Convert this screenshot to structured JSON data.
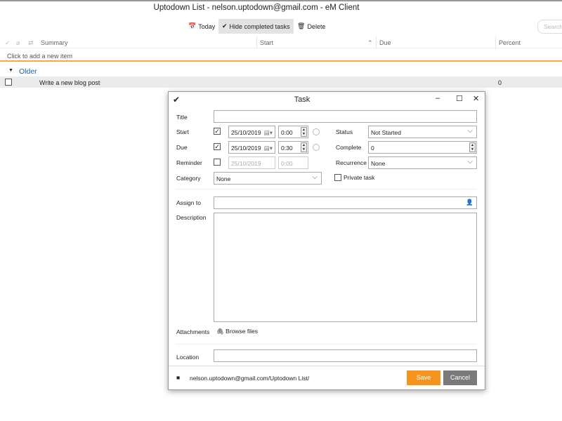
{
  "window": {
    "title": "Uptodown List - nelson.uptodown@gmail.com - eM Client"
  },
  "toolbar": {
    "today": "Today",
    "hide_completed": "Hide completed tasks",
    "delete": "Delete",
    "search_placeholder": "Search"
  },
  "list": {
    "columns": [
      "Summary",
      "Start",
      "Due",
      "Percent"
    ],
    "add_item": "Click to add a new item",
    "group": "Older",
    "rows": [
      {
        "summary": "Write a new blog post",
        "percent": "0"
      }
    ]
  },
  "dialog": {
    "title": "Task",
    "labels": {
      "title": "Title",
      "start": "Start",
      "due": "Due",
      "reminder": "Reminder",
      "category": "Category",
      "status": "Status",
      "complete": "Complete",
      "recurrence": "Recurrence",
      "private": "Private task",
      "assign": "Assign to",
      "description": "Description",
      "attachments": "Attachments",
      "browse": "Browse files",
      "location": "Location"
    },
    "start_date": "25/10/2019",
    "start_time": "0:00",
    "due_date": "25/10/2019",
    "due_time": "0:30",
    "reminder_date": "25/10/2019",
    "reminder_time": "0:00",
    "status": "Not Started",
    "complete": "0",
    "recurrence": "None",
    "category": "None",
    "folder": "nelson.uptodown@gmail.com/Uptodown List/",
    "save": "Save",
    "cancel": "Cancel"
  },
  "colors": {
    "accent": "#f7941d",
    "cancel": "#7a7a7a",
    "group": "#2060a0"
  }
}
